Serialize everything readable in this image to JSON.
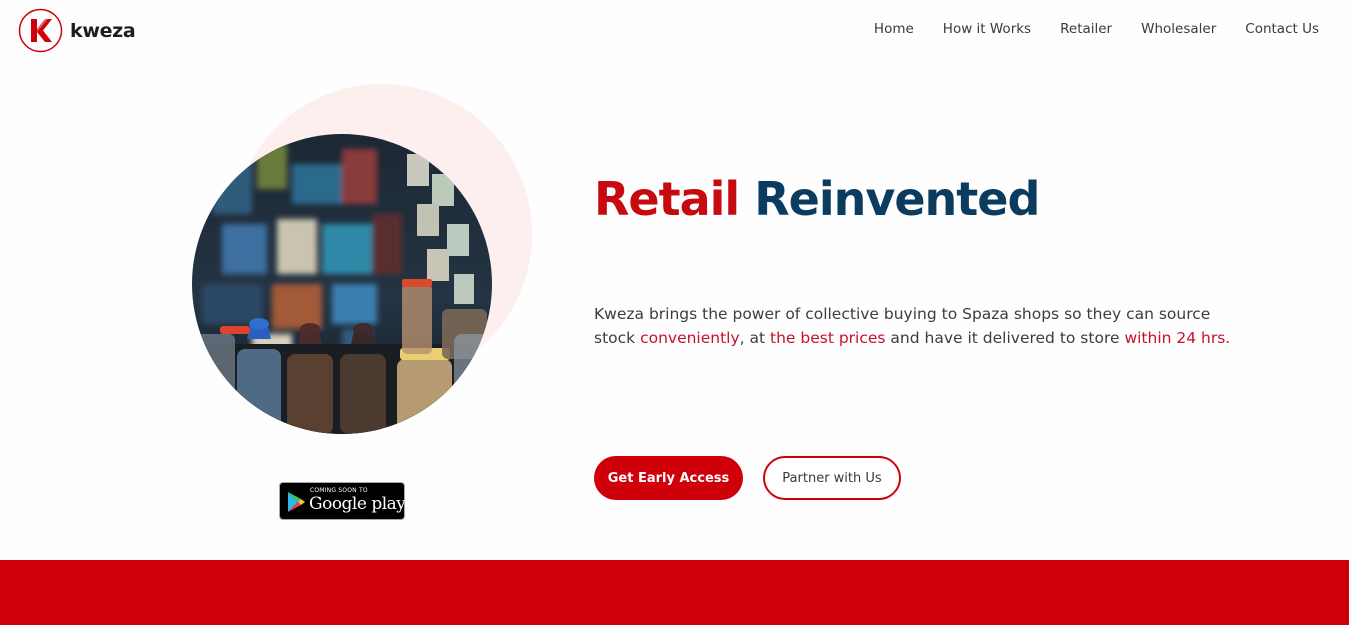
{
  "brand": {
    "name": "kweza",
    "logo_icon": "kweza-k-logo",
    "colors": {
      "primary_red": "#d0000a",
      "navy": "#0b3b5f"
    }
  },
  "nav": {
    "items": [
      {
        "label": "Home"
      },
      {
        "label": "How it Works"
      },
      {
        "label": "Retailer"
      },
      {
        "label": "Wholesaler"
      },
      {
        "label": "Contact Us"
      }
    ]
  },
  "hero": {
    "headline_part1": "Retail",
    "headline_part2": "Reinvented",
    "desc": {
      "t1": "Kweza brings the power of collective buying to Spaza shops so they can source stock ",
      "h1": "conveniently",
      "t2": ", at ",
      "h2": "the best prices",
      "t3": " and have it delivered to store ",
      "h3": "within 24 hrs."
    },
    "primary_cta": "Get Early Access",
    "secondary_cta": "Partner with Us",
    "image": "spaza-shop-jars-photo"
  },
  "store_badge": {
    "top": "COMING SOON TO",
    "bottom": "Google play",
    "icon": "google-play-icon"
  }
}
